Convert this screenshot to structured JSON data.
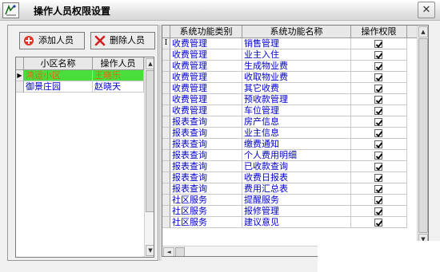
{
  "window": {
    "title": "操作人员权限设置",
    "close_glyph": "✕"
  },
  "toolbar": {
    "add_label": "添加人员",
    "delete_label": "删除人员"
  },
  "left_grid": {
    "columns": [
      "小区名称",
      "操作人员"
    ],
    "rows": [
      {
        "community": "鸿运小区",
        "operator": "王晓乐",
        "selected": true
      },
      {
        "community": "御景庄园",
        "operator": "赵晓天",
        "selected": false
      }
    ]
  },
  "right_grid": {
    "columns": [
      "系统功能类别",
      "系统功能名称",
      "操作权限"
    ],
    "rows": [
      {
        "category": "收费管理",
        "name": "销售管理",
        "permission": true
      },
      {
        "category": "收费管理",
        "name": "业主入住",
        "permission": true
      },
      {
        "category": "收费管理",
        "name": "生成物业费",
        "permission": true
      },
      {
        "category": "收费管理",
        "name": "收取物业费",
        "permission": true
      },
      {
        "category": "收费管理",
        "name": "其它收费",
        "permission": true
      },
      {
        "category": "收费管理",
        "name": "预收款管理",
        "permission": true
      },
      {
        "category": "收费管理",
        "name": "车位管理",
        "permission": true
      },
      {
        "category": "报表查询",
        "name": "房产信息",
        "permission": true
      },
      {
        "category": "报表查询",
        "name": "业主信息",
        "permission": true
      },
      {
        "category": "报表查询",
        "name": "缴费通知",
        "permission": true
      },
      {
        "category": "报表查询",
        "name": "个人费用明细",
        "permission": true
      },
      {
        "category": "报表查询",
        "name": "已收款查询",
        "permission": true
      },
      {
        "category": "报表查询",
        "name": "收费日报表",
        "permission": true
      },
      {
        "category": "报表查询",
        "name": "费用汇总表",
        "permission": true
      },
      {
        "category": "社区服务",
        "name": "提醒服务",
        "permission": true
      },
      {
        "category": "社区服务",
        "name": "报修管理",
        "permission": true
      },
      {
        "category": "社区服务",
        "name": "建议意见",
        "permission": true
      }
    ],
    "current_row_marker": "I"
  },
  "scroll": {
    "up": "▲",
    "down": "▼",
    "left": "◄",
    "right": "►"
  },
  "icons": {
    "app": "app-icon",
    "add": "add-person-icon",
    "delete": "delete-person-icon",
    "row_pointer": "row-pointer-icon"
  },
  "colors": {
    "selected_row": "#4ade3d",
    "selected_text": "#d86a10",
    "cell_text": "#0000cc"
  }
}
